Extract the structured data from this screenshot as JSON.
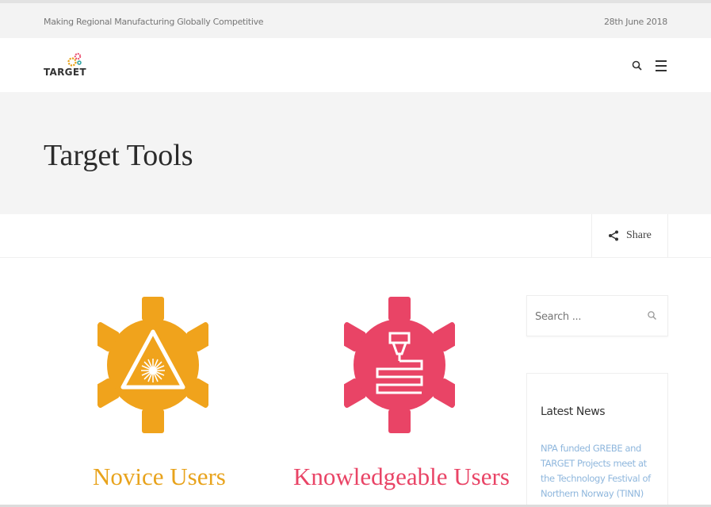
{
  "topbar": {
    "tagline": "Making Regional Manufacturing Globally Competitive",
    "date": "28th June 2018"
  },
  "header": {
    "logo_text": "TARGET",
    "icons": [
      "search-icon",
      "hamburger-menu-icon"
    ]
  },
  "hero": {
    "title": "Target Tools"
  },
  "share": {
    "label": "Share",
    "icon": "share-icon"
  },
  "tools": [
    {
      "label": "Novice Users",
      "icon": "laser-warning-gear-icon",
      "color": "#f0a31c"
    },
    {
      "label": "Knowledgeable Users",
      "icon": "3d-printer-gear-icon",
      "color": "#e94466"
    }
  ],
  "sidebar": {
    "search": {
      "placeholder": "Search ...",
      "icon": "search-icon"
    },
    "latest_news": {
      "title": "Latest News",
      "items": [
        "NPA funded GREBE and TARGET Projects meet at the Technology Festival of Northern Norway (TINN)"
      ]
    }
  },
  "colors": {
    "novice": "#f0a31c",
    "knowledgeable": "#e94466",
    "news_link": "#8fb7dd"
  }
}
